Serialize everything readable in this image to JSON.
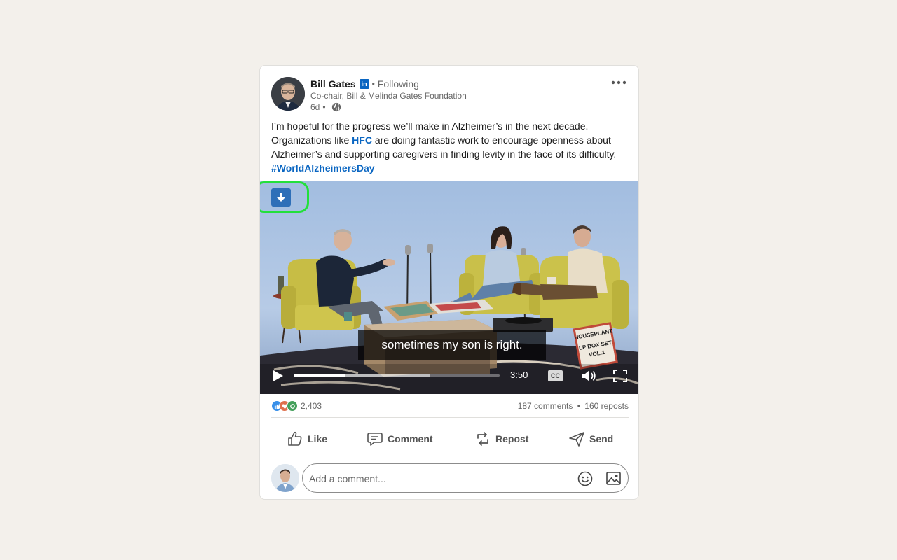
{
  "post": {
    "author": {
      "name": "Bill Gates",
      "badge": "in",
      "follow_status": "Following",
      "headline": "Co-chair, Bill & Melinda Gates Foundation",
      "age": "6d",
      "visibility_icon": "globe-icon"
    },
    "more_icon": "more-options-icon",
    "text": {
      "before_link": "I’m hopeful for the progress we’ll make in Alzheimer’s in the next decade. Organizations like ",
      "link": "HFC",
      "after_link": " are doing fantastic work to encourage openness about Alzheimer’s and supporting caregivers in finding levity in the face of its difficulty. ",
      "hashtag": "#WorldAlzheimersDay"
    }
  },
  "video": {
    "caption": "sometimes my son is right.",
    "time_remaining": "3:50",
    "progress_fraction": 0.25,
    "buffered_fraction": 0.66,
    "cc_label": "CC",
    "book_text": [
      "HOUSEPLANT",
      "LP BOX SET",
      "VOL.1"
    ],
    "download_icon": "download-icon",
    "highlight_color": "#22e03a"
  },
  "stats": {
    "reaction_count": "2,403",
    "comments": "187 comments",
    "separator": "•",
    "reposts": "160 reposts"
  },
  "actions": [
    {
      "label": "Like",
      "icon": "thumbs-up-icon"
    },
    {
      "label": "Comment",
      "icon": "comment-icon"
    },
    {
      "label": "Repost",
      "icon": "repost-icon"
    },
    {
      "label": "Send",
      "icon": "send-icon"
    }
  ],
  "comment": {
    "placeholder": "Add a comment...",
    "emoji_icon": "emoji-icon",
    "image_icon": "image-icon"
  },
  "colors": {
    "link": "#0a66c2",
    "background": "#f3f0eb",
    "card": "#ffffff"
  }
}
